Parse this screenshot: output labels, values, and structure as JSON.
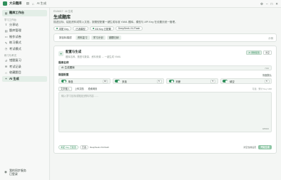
{
  "titlebar": {
    "app_title": "大白题库",
    "breadcrumb": "AI 生成",
    "home_icon": "home-icon",
    "sidebar_toggle_icon": "sidebar-toggle-icon"
  },
  "sidebar": {
    "items": [
      {
        "label": "题库工作台",
        "icon": "dashboard-icon",
        "active": true
      },
      {
        "label": "分享站",
        "icon": "share-icon",
        "active": false
      },
      {
        "label": "题库管理",
        "icon": "library-icon",
        "active": false
      },
      {
        "label": "制作试卷",
        "icon": "document-icon",
        "active": false
      },
      {
        "label": "练习模式",
        "icon": "practice-icon",
        "active": false
      },
      {
        "label": "考试模式",
        "icon": "exam-icon",
        "active": false
      },
      {
        "label": "错题复习",
        "icon": "review-icon",
        "active": false
      },
      {
        "label": "考试记录",
        "icon": "history-icon",
        "active": false
      },
      {
        "label": "收藏题目",
        "icon": "star-icon",
        "active": false
      },
      {
        "label": "AI 生成",
        "icon": "ai-icon",
        "active": true
      }
    ],
    "section_study": "学习工作台",
    "section_practice": "练习与考试",
    "footer": "我的同步服务\n已登录"
  },
  "main": {
    "eyebrow": "EXAM17 · AI 生成",
    "title": "生成题库",
    "subtitle": "描述目标、粘贴资料或导入文档，按题型配置一键生成标准 YAML 题库。模型与 API Key 在设置页统一管理。",
    "chips": [
      "未配 Key",
      "已选模型",
      "0/8 Key 已配置",
      "DeepSeek-V4-Flash"
    ],
    "tabs": [
      "按目标描述",
      "资料复习",
      "学习计划",
      "错题归纳"
    ],
    "tabs_right": "示例"
  },
  "card": {
    "title": "配置与生成",
    "subtitle": "题库名称、题型与数量、资料来源 → 一键生成 YAML",
    "head_buttons": [
      "AI 调整配置",
      "清空"
    ],
    "bank_name_label": "题库名称",
    "bank_name_value": "AI 生成题库",
    "bank_name_counter": "7/40",
    "question_types_label": "题型配置",
    "reset_label": "恢复默认",
    "question_types": [
      {
        "label": "单选",
        "count": "10"
      },
      {
        "label": "多选",
        "count": "5"
      },
      {
        "label": "判断",
        "count": "5"
      },
      {
        "label": "填空",
        "count": "5"
      }
    ],
    "source_tabs": [
      "文本输入",
      "上传文档",
      "检索网页"
    ],
    "source_right": "可选 · 预计 Key 1/40",
    "textarea_placeholder": "输入学习目标或粘贴资料内容……",
    "textarea_counter": "0/8000",
    "footer_chips": [
      "未配 Key 已配置",
      "已选"
    ],
    "footer_model": "DeepSeek-V4-Flash",
    "footer_right_text": "清空当前设定",
    "generate_button": "开始生成"
  },
  "colors": {
    "accent": "#2f8f5b",
    "accent_light": "#e3eee7",
    "primary_button": "#8ec6a5"
  }
}
